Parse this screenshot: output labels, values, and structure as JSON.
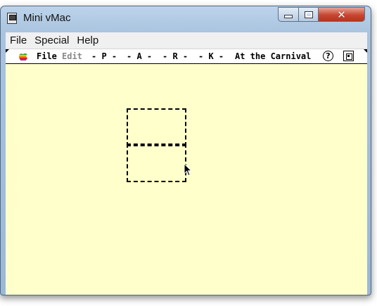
{
  "window": {
    "title": "Mini vMac",
    "close_glyph": "✕",
    "menu": [
      "File",
      "Special",
      "Help"
    ]
  },
  "mac": {
    "menubar": [
      {
        "label": "File",
        "disabled": false
      },
      {
        "label": "Edit",
        "disabled": true
      },
      {
        "label": "- P -",
        "disabled": false
      },
      {
        "label": "- A -",
        "disabled": false
      },
      {
        "label": "- R -",
        "disabled": false
      },
      {
        "label": "- K -",
        "disabled": false
      },
      {
        "label": "At the Carnival",
        "disabled": false
      }
    ],
    "help_glyph": "?",
    "icons": [
      "apple-icon",
      "help-icon",
      "application-menu-icon"
    ]
  },
  "colors": {
    "screen_bg": "#ffffcc",
    "titlebar": "#a9c3df",
    "close_button": "#c8462f"
  }
}
